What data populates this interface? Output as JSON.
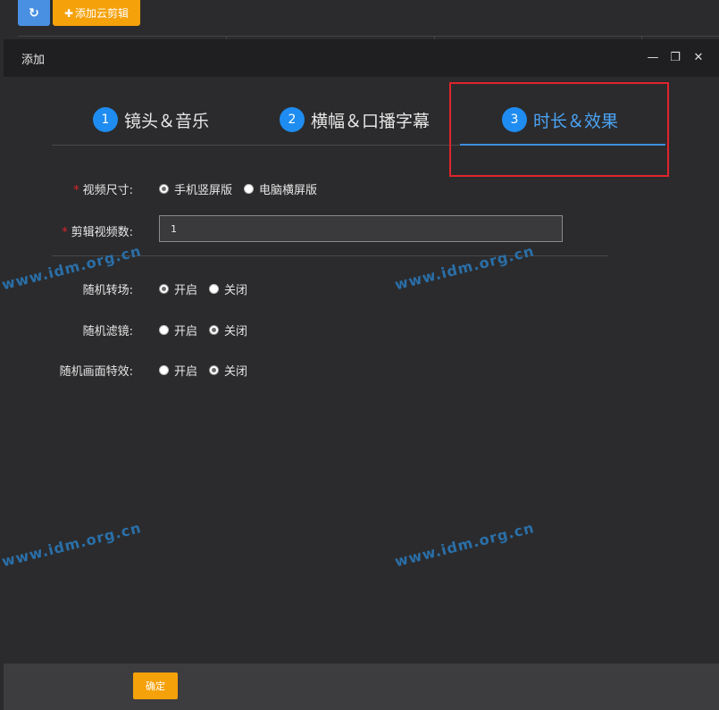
{
  "toolbar": {
    "refresh_icon": "↻",
    "add_icon": "✚",
    "add_label": "添加云剪辑"
  },
  "modal": {
    "title": "添加",
    "minimize_icon": "—",
    "maximize_icon": "❐",
    "close_icon": "✕"
  },
  "steps": [
    {
      "num": "1",
      "label": "镜头＆音乐"
    },
    {
      "num": "2",
      "label": "横幅＆口播字幕"
    },
    {
      "num": "3",
      "label": "时长＆效果"
    }
  ],
  "form": {
    "video_size": {
      "required_mark": "*",
      "label": "视频尺寸:",
      "options": [
        "手机竖屏版",
        "电脑横屏版"
      ],
      "selected": "手机竖屏版"
    },
    "clip_count": {
      "required_mark": "*",
      "label": "剪辑视频数:",
      "value": "1"
    },
    "random_transition": {
      "label": "随机转场:",
      "options": [
        "开启",
        "关闭"
      ],
      "selected": "开启"
    },
    "random_filter": {
      "label": "随机滤镜:",
      "options": [
        "开启",
        "关闭"
      ],
      "selected": "关闭"
    },
    "random_effect": {
      "label": "随机画面特效:",
      "options": [
        "开启",
        "关闭"
      ],
      "selected": "关闭"
    }
  },
  "watermarks": [
    "www.idm.org.cn",
    "www.idm.org.cn",
    "www.idm.org.cn",
    "www.idm.org.cn"
  ],
  "footer": {
    "ok_label": "确定"
  },
  "colors": {
    "accent_blue": "#1e8cf0",
    "accent_orange": "#f5a10a",
    "highlight_red": "#e0242c",
    "background": "#2b2b2d"
  }
}
